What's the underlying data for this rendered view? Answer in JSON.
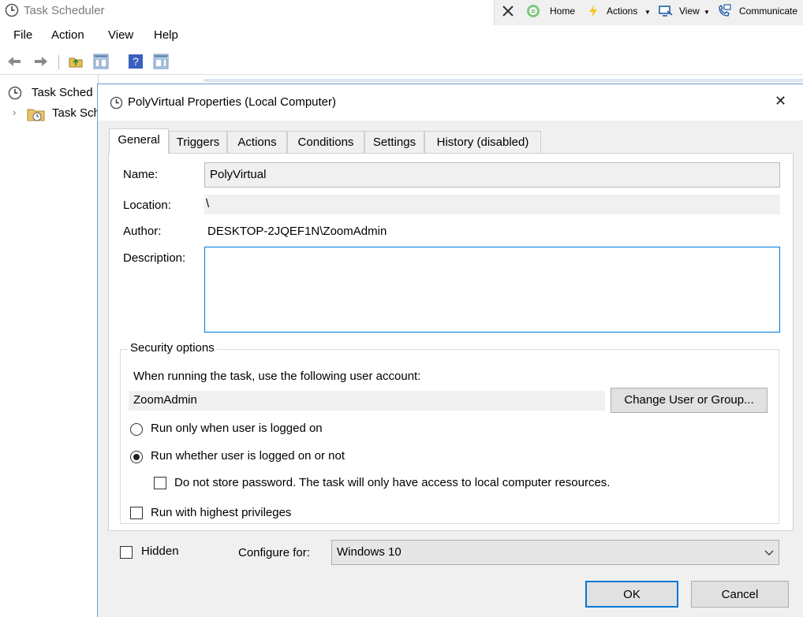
{
  "window": {
    "title": "Task Scheduler"
  },
  "ext_toolbar": {
    "home": "Home",
    "actions": "Actions",
    "view": "View",
    "communicate": "Communicate"
  },
  "menu": [
    "File",
    "Action",
    "View",
    "Help"
  ],
  "tree": {
    "root": "Task Sched",
    "child": "Task Sch"
  },
  "dialog": {
    "title": "PolyVirtual Properties (Local Computer)",
    "close_glyph": "✕",
    "tabs": [
      "General",
      "Triggers",
      "Actions",
      "Conditions",
      "Settings",
      "History (disabled)"
    ],
    "general": {
      "name_label": "Name:",
      "name_value": "PolyVirtual",
      "location_label": "Location:",
      "location_value": "\\",
      "author_label": "Author:",
      "author_value": "DESKTOP-2JQEF1N\\ZoomAdmin",
      "description_label": "Description:",
      "description_value": "",
      "security": {
        "title": "Security options",
        "account_prompt": "When running the task, use the following user account:",
        "account_value": "ZoomAdmin",
        "change_button": "Change User or Group...",
        "radio_logged_on": "Run only when user is logged on",
        "radio_whether": "Run whether user is logged on or not",
        "selected_radio": "radio_whether",
        "no_store_password": "Do not store password.  The task will only have access to local computer resources.",
        "no_store_password_checked": false,
        "highest_privileges": "Run with highest privileges",
        "highest_privileges_checked": false
      },
      "hidden_label": "Hidden",
      "hidden_checked": false,
      "configure_label": "Configure for:",
      "configure_value": "Windows 10"
    },
    "ok_button": "OK",
    "cancel_button": "Cancel"
  },
  "colors": {
    "accent_border": "#6d9bd1",
    "ok_border": "#0078d7",
    "field_focus_border": "#0078d7"
  }
}
